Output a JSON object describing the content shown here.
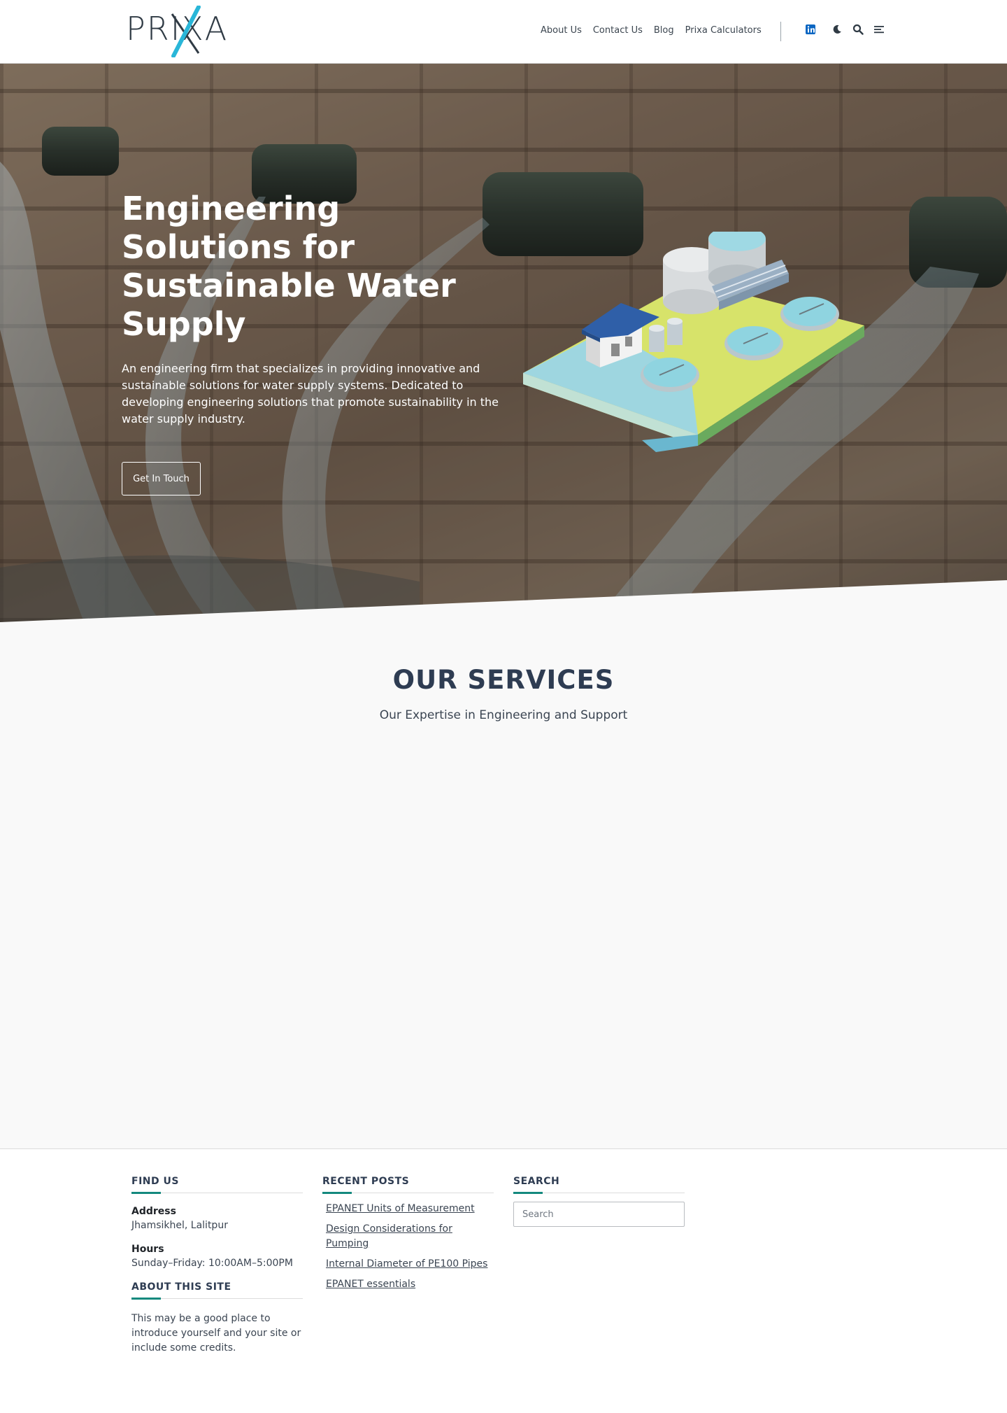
{
  "brand": {
    "logo_text": "PRIXA",
    "accent": "#29b6d8"
  },
  "nav": {
    "items": [
      {
        "label": "About Us"
      },
      {
        "label": "Contact Us"
      },
      {
        "label": "Blog"
      },
      {
        "label": "Prixa Calculators"
      }
    ],
    "icons": [
      "linkedin-icon",
      "moon-icon",
      "search-icon",
      "menu-icon"
    ]
  },
  "hero": {
    "title": "Engineering Solutions for Sustainable Water Supply",
    "description": "An engineering firm that specializes in providing innovative and sustainable solutions for water supply systems. Dedicated to developing engineering solutions that promote sustainability in the water supply industry.",
    "cta_label": "Get In Touch"
  },
  "services": {
    "title": "OUR SERVICES",
    "subtitle": "Our Expertise in Engineering and Support"
  },
  "footer": {
    "find_us": {
      "heading": "FIND US",
      "address_label": "Address",
      "address_value": "Jhamsikhel, Lalitpur",
      "hours_label": "Hours",
      "hours_value": "Sunday–Friday: 10:00AM–5:00PM"
    },
    "about": {
      "heading": "ABOUT THIS SITE",
      "text": "This may be a good place to introduce yourself and your site or include some credits."
    },
    "recent_posts": {
      "heading": "RECENT POSTS",
      "items": [
        {
          "label": "EPANET Units of Measurement"
        },
        {
          "label": "Design Considerations for Pumping"
        },
        {
          "label": "Internal Diameter of PE100 Pipes"
        },
        {
          "label": "EPANET essentials"
        }
      ]
    },
    "search": {
      "heading": "SEARCH",
      "placeholder": "Search"
    }
  },
  "colors": {
    "heading": "#2e3c52",
    "footer_accent": "#14897e",
    "linkedin": "#0a66c2"
  }
}
